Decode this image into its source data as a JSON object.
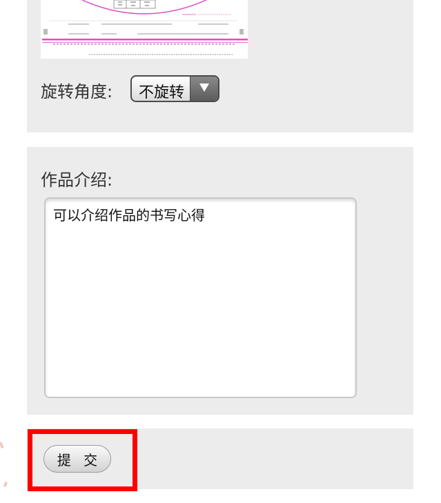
{
  "form": {
    "rotate": {
      "label": "旋转角度:",
      "selected": "不旋转"
    },
    "intro": {
      "label": "作品介绍:",
      "placeholder": "可以介绍作品的书写心得"
    },
    "submit_label": "提 交"
  },
  "colors": {
    "panel_bg": "#ececec",
    "highlight": "#ff0000",
    "certificate_accent": "#e04bbf"
  }
}
